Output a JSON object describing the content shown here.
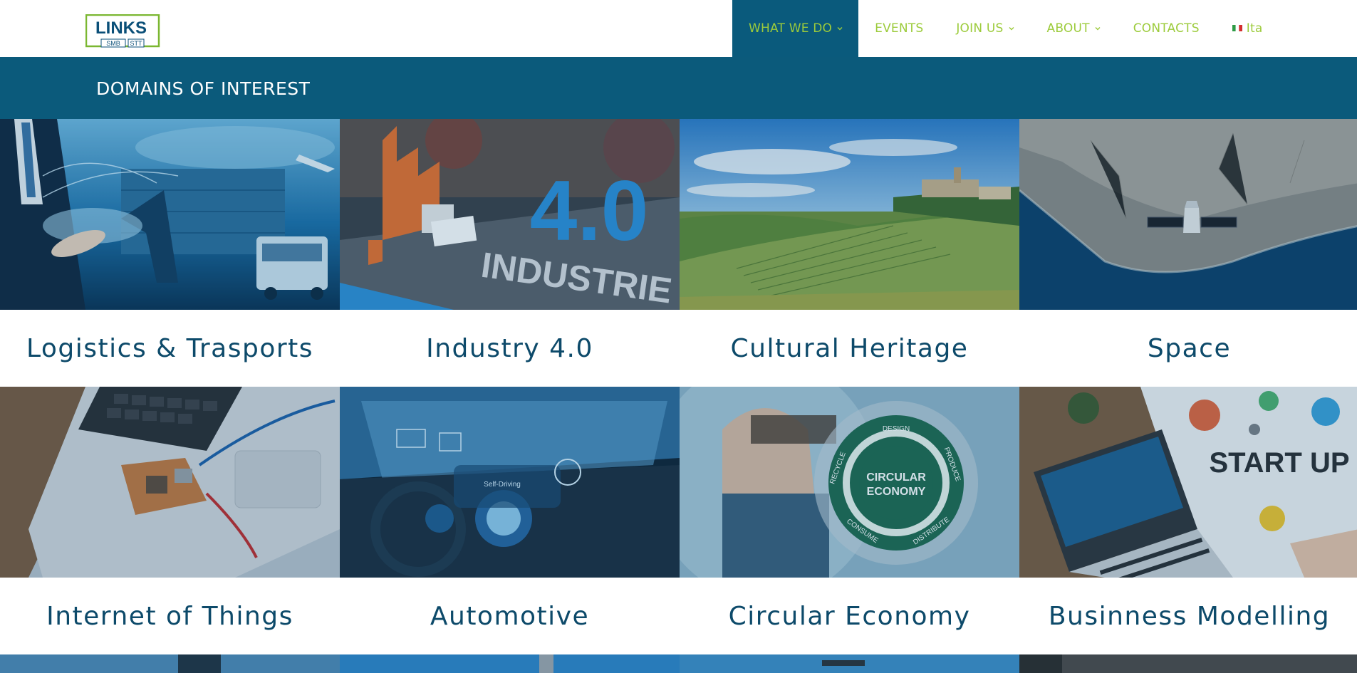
{
  "logo": {
    "main": "LINKS",
    "sub1": "SMB",
    "sub2": "STT",
    "brand_color": "#7bb731",
    "dark_color": "#0a4f78"
  },
  "nav": {
    "items": [
      {
        "label": "WHAT WE DO",
        "dropdown": true,
        "active": true
      },
      {
        "label": "EVENTS",
        "dropdown": false,
        "active": false
      },
      {
        "label": "JOIN US",
        "dropdown": true,
        "active": false
      },
      {
        "label": "ABOUT",
        "dropdown": true,
        "active": false
      },
      {
        "label": "CONTACTS",
        "dropdown": false,
        "active": false
      },
      {
        "label": "Ita",
        "dropdown": false,
        "active": false,
        "icon": "italian-flag-icon"
      }
    ],
    "color": "#9ccb3b",
    "active_bg": "#0a5a7c"
  },
  "titlebar": {
    "title": "DOMAINS OF INTEREST",
    "bg": "#0b5a7b"
  },
  "domains": [
    {
      "label": "Logistics & Trasports",
      "image": "logistics-image"
    },
    {
      "label": "Industry 4.0",
      "image": "industry-image"
    },
    {
      "label": "Cultural Heritage",
      "image": "vineyard-village-image"
    },
    {
      "label": "Space",
      "image": "satellite-coast-image"
    },
    {
      "label": "Internet of Things",
      "image": "laptop-board-image"
    },
    {
      "label": "Automotive",
      "image": "car-dashboard-image"
    },
    {
      "label": "Circular Economy",
      "image": "circular-economy-image"
    },
    {
      "label": "Businness Modelling",
      "image": "startup-desk-image"
    }
  ],
  "industry_image_text": {
    "big": "4.0",
    "word": "INDUSTRIE"
  },
  "circular_image_text": {
    "center": [
      "CIRCULAR",
      "ECONOMY"
    ],
    "words": [
      "DESIGN",
      "PRODUCE",
      "DISTRIBUTE",
      "CONSUME",
      "RECYCLE"
    ]
  },
  "startup_image_text": "START UP",
  "car_image_text": "Self-Driving"
}
